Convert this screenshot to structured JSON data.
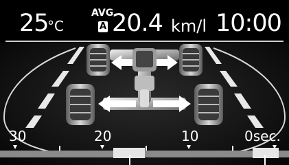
{
  "status": {
    "temperature": "25",
    "temperature_unit": "°C",
    "avg_label": "AVG.",
    "mode_badge": "A",
    "fuel_economy": "20.4",
    "fuel_unit": "km/l",
    "clock": "10:00"
  },
  "timeline": {
    "labels": [
      "30",
      "20",
      "10",
      "0sec."
    ]
  },
  "colors": {
    "background": "#000000",
    "text": "#ffffff",
    "scale_bar": "#bfbfbf"
  },
  "icons": [
    "awd-drivetrain-icon",
    "torque-arrow-icon",
    "time-marker-icon"
  ]
}
